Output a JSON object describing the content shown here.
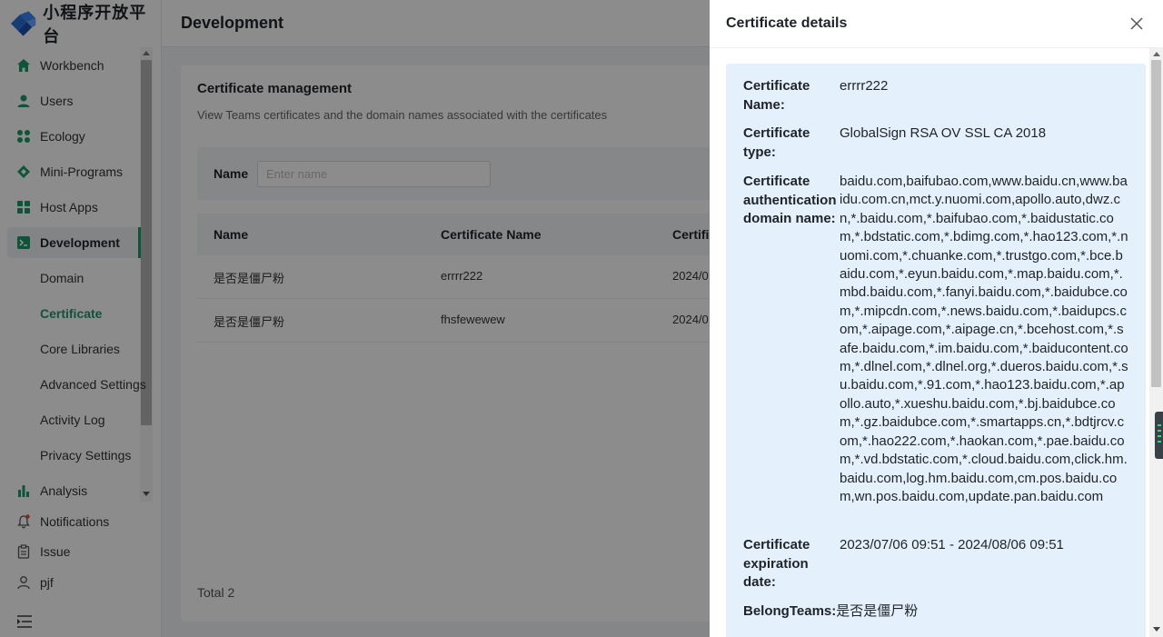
{
  "app": {
    "brand_name": "小程序开放平台",
    "brand_color": "#1b9a6a"
  },
  "sidebar": {
    "items": [
      {
        "label": "Workbench",
        "icon": "home-icon"
      },
      {
        "label": "Users",
        "icon": "user-icon"
      },
      {
        "label": "Ecology",
        "icon": "grid-dots-icon"
      },
      {
        "label": "Mini-Programs",
        "icon": "diamond-icon"
      },
      {
        "label": "Host Apps",
        "icon": "apps-grid-icon"
      },
      {
        "label": "Development",
        "icon": "terminal-icon",
        "active": true
      }
    ],
    "sub_items": [
      {
        "label": "Domain"
      },
      {
        "label": "Certificate",
        "active": true
      },
      {
        "label": "Core Libraries"
      },
      {
        "label": "Advanced Settings"
      },
      {
        "label": "Activity Log"
      },
      {
        "label": "Privacy Settings"
      }
    ],
    "analysis": {
      "label": "Analysis",
      "icon": "bar-chart-icon"
    },
    "notifications": {
      "label": "Notifications",
      "icon": "bell-icon"
    },
    "issue": {
      "label": "Issue",
      "icon": "clipboard-icon"
    },
    "user": {
      "label": "pjf",
      "icon": "person-outline-icon"
    }
  },
  "header": {
    "title": "Development"
  },
  "page": {
    "title": "Certificate management",
    "description": "View Teams certificates and the domain names associated with the certificates",
    "filter": {
      "label": "Name",
      "placeholder": "Enter name",
      "value": ""
    },
    "table": {
      "columns": [
        "Name",
        "Certificate Name",
        "Certifi"
      ],
      "rows": [
        {
          "name": "是否是僵尸粉",
          "certificate_name": "errrr222",
          "date": "2024/0"
        },
        {
          "name": "是否是僵尸粉",
          "certificate_name": "fhsfewewew",
          "date": "2024/0"
        }
      ]
    },
    "total": "Total 2"
  },
  "drawer": {
    "title": "Certificate details",
    "close_icon": "close-icon",
    "fields": {
      "name": {
        "label": "Certificate Name:",
        "value": "errrr222"
      },
      "type": {
        "label": "Certificate type:",
        "value": "GlobalSign RSA OV SSL CA 2018"
      },
      "domains": {
        "label": "Certificate authentication domain name:",
        "value": "baidu.com,baifubao.com,www.baidu.cn,www.baidu.com.cn,mct.y.nuomi.com,apollo.auto,dwz.cn,*.baidu.com,*.baifubao.com,*.baidustatic.com,*.bdstatic.com,*.bdimg.com,*.hao123.com,*.nuomi.com,*.chuanke.com,*.trustgo.com,*.bce.baidu.com,*.eyun.baidu.com,*.map.baidu.com,*.mbd.baidu.com,*.fanyi.baidu.com,*.baidubce.com,*.mipcdn.com,*.news.baidu.com,*.baidupcs.com,*.aipage.com,*.aipage.cn,*.bcehost.com,*.safe.baidu.com,*.im.baidu.com,*.baiducontent.com,*.dlnel.com,*.dlnel.org,*.dueros.baidu.com,*.su.baidu.com,*.91.com,*.hao123.baidu.com,*.apollo.auto,*.xueshu.baidu.com,*.bj.baidubce.com,*.gz.baidubce.com,*.smartapps.cn,*.bdtjrcv.com,*.hao222.com,*.haokan.com,*.pae.baidu.com,*.vd.bdstatic.com,*.cloud.baidu.com,click.hm.baidu.com,log.hm.baidu.com,cm.pos.baidu.com,wn.pos.baidu.com,update.pan.baidu.com"
      },
      "expiration": {
        "label": "Certificate expiration date:",
        "value": "2023/07/06 09:51 - 2024/08/06 09:51"
      },
      "belong_teams": {
        "label": "BelongTeams:",
        "value": "是否是僵尸粉"
      }
    }
  }
}
